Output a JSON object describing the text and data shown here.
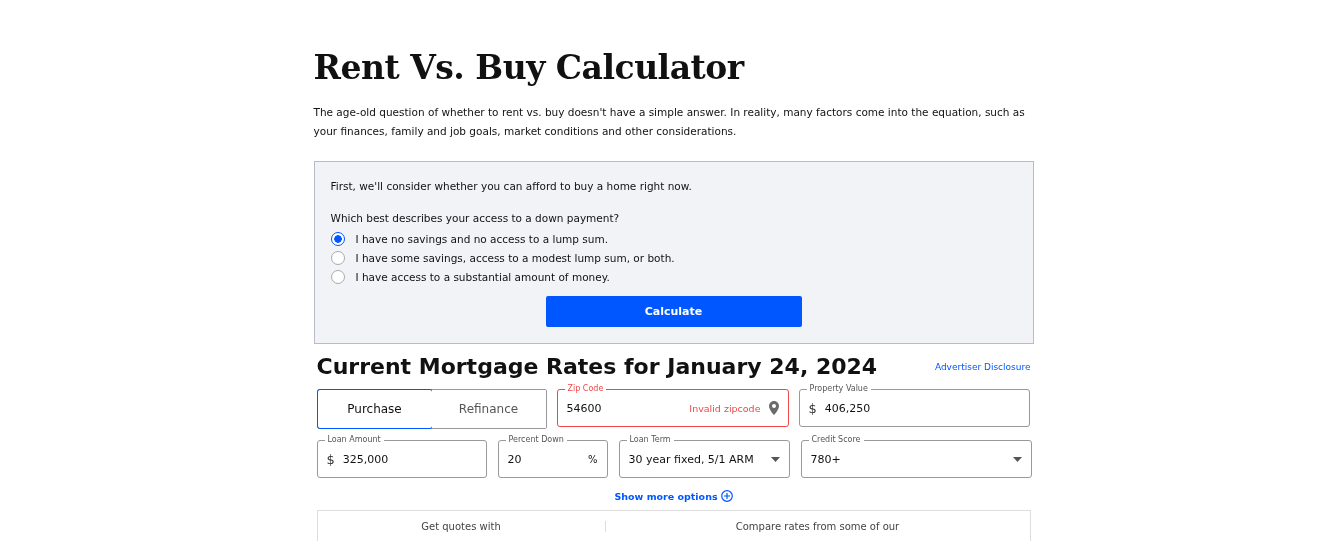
{
  "title": "Rent Vs. Buy Calculator",
  "intro": "The age-old question of whether to rent vs. buy doesn't have a simple answer. In reality, many factors come into the equation, such as your finances, family and job goals, market conditions and other considerations.",
  "calculator": {
    "lead": "First, we'll consider whether you can afford to buy a home right now.",
    "question": "Which best describes your access to a down payment?",
    "options": [
      {
        "label": "I have no savings and no access to a lump sum.",
        "selected": true
      },
      {
        "label": "I have some savings, access to a modest lump sum, or both.",
        "selected": false
      },
      {
        "label": "I have access to a substantial amount of money.",
        "selected": false
      }
    ],
    "button": "Calculate"
  },
  "rates": {
    "heading": "Current Mortgage Rates for January 24, 2024",
    "disclosure": "Advertiser Disclosure",
    "tabs": [
      {
        "label": "Purchase",
        "selected": true
      },
      {
        "label": "Refinance",
        "selected": false
      }
    ],
    "zip": {
      "label": "Zip Code",
      "value": "54600",
      "error": "Invalid zipcode"
    },
    "property_value": {
      "label": "Property Value",
      "prefix": "$",
      "value": "406,250"
    },
    "loan_amount": {
      "label": "Loan Amount",
      "prefix": "$",
      "value": "325,000"
    },
    "percent_down": {
      "label": "Percent Down",
      "value": "20",
      "suffix": "%"
    },
    "loan_term": {
      "label": "Loan Term",
      "value": "30 year fixed, 5/1 ARM"
    },
    "credit_score": {
      "label": "Credit Score",
      "value": "780+"
    },
    "more": "Show more options",
    "panel": [
      "Get quotes with",
      "Compare rates from some of our"
    ]
  }
}
